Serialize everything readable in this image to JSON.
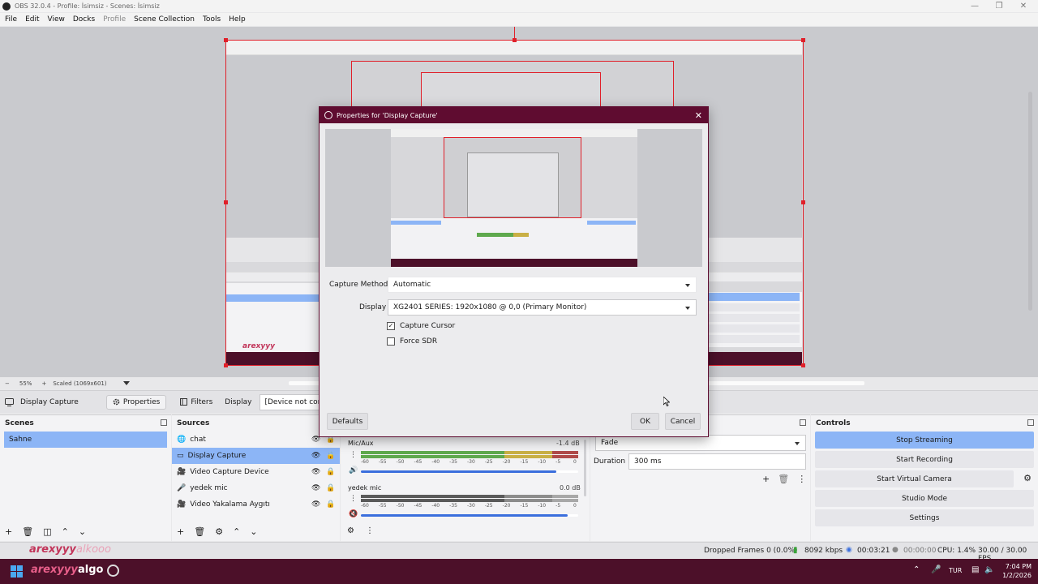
{
  "window": {
    "title": "OBS 32.0.4 - Profile: İsimsiz - Scenes: İsimsiz"
  },
  "menu": [
    "File",
    "Edit",
    "View",
    "Docks",
    "Profile",
    "Scene Collection",
    "Tools",
    "Help"
  ],
  "preview_toolbar": {
    "zoom_minus": "−",
    "zoom": "55%",
    "zoom_plus": "+",
    "scale": "Scaled (1069x601)"
  },
  "source_toolbar": {
    "source_name": "Display Capture",
    "properties": "Properties",
    "filters": "Filters",
    "display_label": "Display",
    "display_value": "[Device not conne"
  },
  "scenes": {
    "title": "Scenes",
    "items": [
      "Sahne"
    ]
  },
  "sources": {
    "title": "Sources",
    "items": [
      {
        "name": "chat",
        "icon": "globe-icon"
      },
      {
        "name": "Display Capture",
        "icon": "monitor-icon"
      },
      {
        "name": "Video Capture Device",
        "icon": "camera-icon"
      },
      {
        "name": "yedek mic",
        "icon": "mic-icon"
      },
      {
        "name": "Video Yakalama Aygıtı",
        "icon": "camera-icon"
      }
    ]
  },
  "mixer": {
    "channels": [
      {
        "name": "Mic/Aux",
        "level": "-1.4 dB",
        "volume": 0.9,
        "muted": false
      },
      {
        "name": "yedek mic",
        "level": "0.0 dB",
        "volume": 0.95,
        "muted": true
      }
    ],
    "ticks": [
      "-60",
      "-55",
      "-50",
      "-45",
      "-40",
      "-35",
      "-30",
      "-25",
      "-20",
      "-15",
      "-10",
      "-5",
      "0"
    ]
  },
  "transitions": {
    "type": "Fade",
    "duration_label": "Duration",
    "duration": "300 ms"
  },
  "controls": {
    "title": "Controls",
    "buttons": [
      "Stop Streaming",
      "Start Recording",
      "Start Virtual Camera",
      "Studio Mode",
      "Settings"
    ]
  },
  "dialog": {
    "title": "Properties for 'Display Capture'",
    "capture_method_label": "Capture Method",
    "capture_method": "Automatic",
    "display_label": "Display",
    "display": "XG2401 SERIES: 1920x1080 @ 0,0 (Primary Monitor)",
    "capture_cursor": "Capture Cursor",
    "capture_cursor_checked": true,
    "force_sdr": "Force SDR",
    "force_sdr_checked": false,
    "defaults": "Defaults",
    "ok": "OK",
    "cancel": "Cancel"
  },
  "status": {
    "dropped": "Dropped Frames 0 (0.0%)",
    "bitrate": "8092 kbps",
    "stream_time": "00:03:21",
    "rec_time": "00:00:00",
    "cpu": "CPU: 1.4%",
    "fps": "30.00 / 30.00 FPS"
  },
  "overlay_text": {
    "left": "arexyyy",
    "right": "alkooo"
  },
  "taskbar": {
    "lang": "TUR",
    "time": "7:04 PM",
    "date": "1/2/2026",
    "algo": "algo"
  },
  "colors": {
    "accent": "#8cb5f6",
    "titlebar": "#5f0c30",
    "taskbar": "#4c1029",
    "frame_red": "#e0202a"
  }
}
